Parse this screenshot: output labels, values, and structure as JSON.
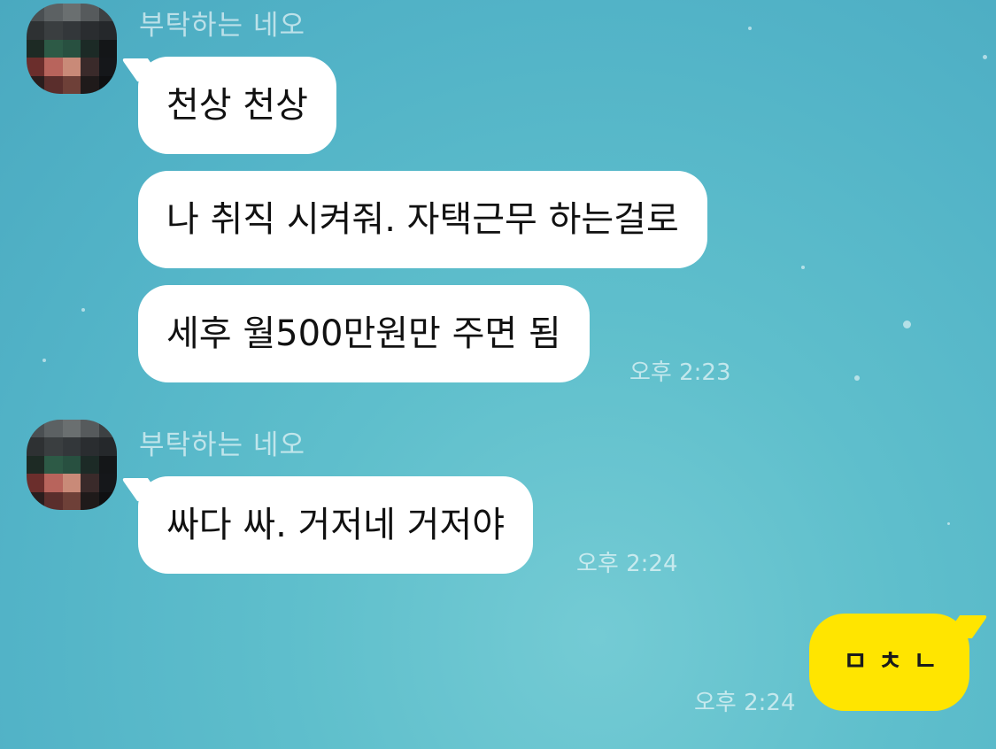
{
  "chat": {
    "background_color": "#5bbccb",
    "groups": [
      {
        "sender": "부탁하는 네오",
        "messages": [
          {
            "text": "천상 천상"
          },
          {
            "text": "나 취직 시켜줘. 자택근무 하는걸로"
          },
          {
            "text": "세후 월500만원만 주면 됨",
            "time": "오후 2:23"
          }
        ]
      },
      {
        "sender": "부탁하는 네오",
        "messages": [
          {
            "text": "싸다 싸. 거저네 거저야",
            "time": "오후 2:24"
          }
        ]
      }
    ],
    "my_message": {
      "text": "ㅁㅊㄴ",
      "time": "오후 2:24",
      "bubble_color": "#ffe500"
    }
  }
}
